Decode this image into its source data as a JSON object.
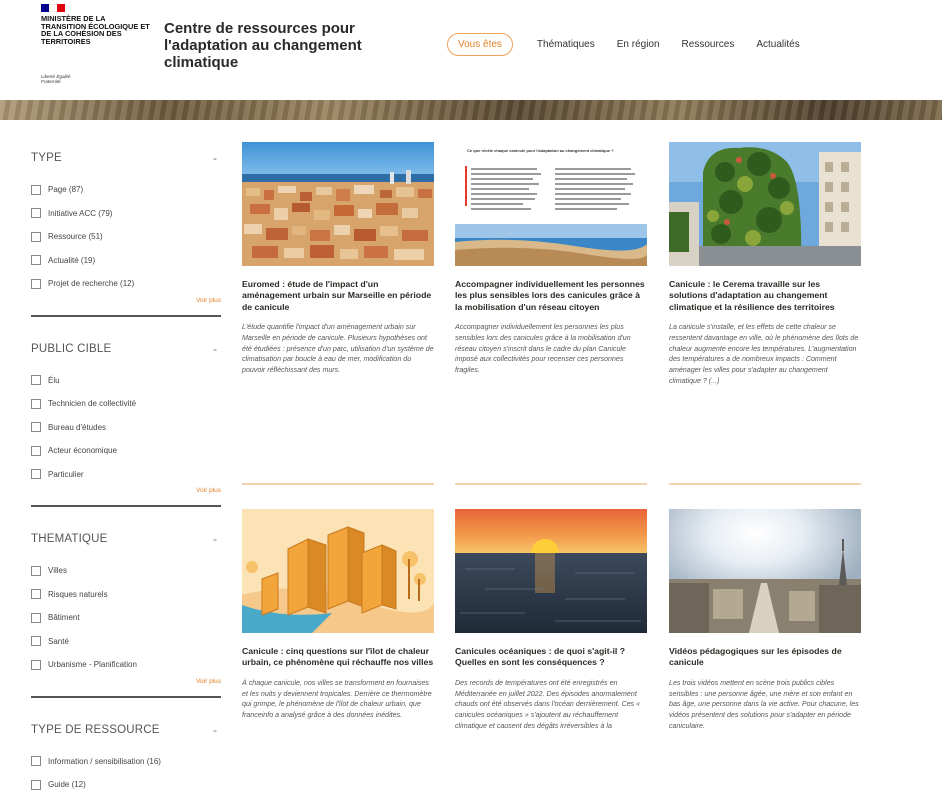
{
  "header": {
    "flag_colors": [
      "#000091",
      "#ffffff",
      "#e1000f"
    ],
    "ministry": "Ministère de la transition écologique et de la cohésion des territoires",
    "motto": "Liberté Égalité Fraternité",
    "site_title": "Centre de ressources pour l'adaptation au changement climatique",
    "nav": [
      {
        "label": "Vous êtes"
      },
      {
        "label": "Thématiques"
      },
      {
        "label": "En région"
      },
      {
        "label": "Ressources"
      },
      {
        "label": "Actualités"
      }
    ]
  },
  "filters": [
    {
      "title": "TYPE",
      "collapse": "-",
      "options": [
        "Page (87)",
        "Initiative ACC (79)",
        "Ressource (51)",
        "Actualité (19)",
        "Projet de recherche (12)"
      ],
      "more": "Voir plus"
    },
    {
      "title": "PUBLIC CIBLE",
      "collapse": "-",
      "options": [
        "Élu",
        "Technicien de collectivité",
        "Bureau d'études",
        "Acteur économique",
        "Particulier"
      ],
      "more": "Voir plus"
    },
    {
      "title": "THEMATIQUE",
      "collapse": "-",
      "options": [
        "Villes",
        "Risques naturels",
        "Bâtiment",
        "Santé",
        "Urbanisme - Planification"
      ],
      "more": "Voir plus"
    },
    {
      "title": "TYPE DE RESSOURCE",
      "collapse": "-",
      "options": [
        "Information / sensibilisation (16)",
        "Guide (12)"
      ],
      "more": ""
    }
  ],
  "cards": [
    {
      "title": "Euromed : étude de l'impact d'un aménagement urbain sur Marseille en période de canicule",
      "desc": "L'étude quantifie l'impact d'un aménagement urbain sur Marseille en période de canicule. Plusieurs hypothèses ont été étudiées : présence d'un parc, utilisation d'un système de climatisation par boucle à eau de mer, modification du pouvoir réfléchissant des murs."
    },
    {
      "title": "Accompagner individuellement les personnes les plus sensibles lors des canicules grâce à la mobilisation d'un réseau citoyen",
      "desc": "Accompagner individuellement les personnes les plus sensibles lors des canicules grâce à la mobilisation d'un réseau citoyen s'inscrit dans le cadre du plan Canicule imposé aux collectivités pour recenser ces personnes fragiles."
    },
    {
      "title": "Canicule : le Cerema travaille sur les solutions d'adaptation au changement climatique et la résilience des territoires",
      "desc": "La canicule s'installe, et les effets de cette chaleur se ressentent davantage en ville, où le phénomène des îlots de chaleur augmente encore les températures. L'augmentation des températures a de nombreux impacts : Comment aménager les villes pour s'adapter au changement climatique ? (...)"
    },
    {
      "title": "Canicule : cinq questions sur l'îlot de chaleur urbain, ce phénomène qui réchauffe nos villes",
      "desc": "À chaque canicule, nos villes se transforment en fournaises et les nuits y deviennent tropicales. Derrière ce thermomètre qui grimpe, le phénomène de l'îlot de chaleur urbain, que franceinfo a analysé grâce à des données inédites."
    },
    {
      "title": "Canicules océaniques : de quoi s'agit-il ? Quelles en sont les conséquences ?",
      "desc": "Des records de températures ont été enregistrés en Méditerranée en juillet 2022. Des épisodes anormalement chauds ont été observés dans l'océan dernièrement. Ces « canicules océaniques » s'ajoutent au réchauffement climatique et causent des dégâts irréversibles à la"
    },
    {
      "title": "Vidéos pédagogiques sur les épisodes de canicule",
      "desc": "Les trois vidéos mettent en scène trois publics cibles sensibles : une personne âgée, une mère et son enfant en bas âge, une personne dans la vie active. Pour chacune, les vidéos présentent des solutions pour s'adapter en période caniculaire."
    }
  ],
  "document_thumbnail": {
    "heading": "Ce que révèle chaque canicule pour l'adaptation au changement climatique ?"
  },
  "colors": {
    "accent": "#e0822a",
    "rule": "#f6d3b0"
  }
}
